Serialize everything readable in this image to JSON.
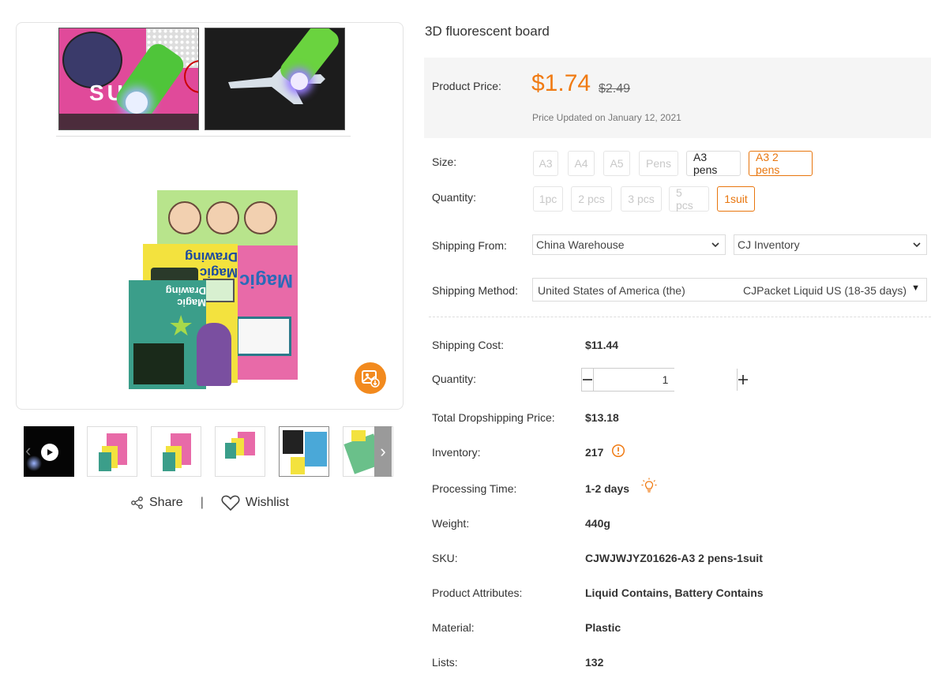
{
  "product": {
    "title": "3D fluorescent board",
    "price_label": "Product Price:",
    "price_current": "$1.74",
    "price_original": "$2.49",
    "price_updated": "Price Updated on January 12, 2021"
  },
  "variants": {
    "size_label": "Size:",
    "sizes": [
      {
        "label": "A3",
        "state": "disabled"
      },
      {
        "label": "A4",
        "state": "disabled"
      },
      {
        "label": "A5",
        "state": "disabled"
      },
      {
        "label": "Pens",
        "state": "disabled"
      },
      {
        "label": "A3 pens",
        "state": "enabled"
      },
      {
        "label": "A3 2 pens",
        "state": "selected"
      }
    ],
    "quantity_label": "Quantity:",
    "quantities": [
      {
        "label": "1pc",
        "state": "disabled"
      },
      {
        "label": "2 pcs",
        "state": "disabled"
      },
      {
        "label": "3 pcs",
        "state": "disabled"
      },
      {
        "label": "5 pcs",
        "state": "disabled"
      },
      {
        "label": "1suit",
        "state": "selected"
      }
    ]
  },
  "shipping": {
    "from_label": "Shipping From:",
    "from_value": "China Warehouse",
    "inventory_value": "CJ Inventory",
    "method_label": "Shipping Method:",
    "method_country": "United States of America (the)",
    "method_carrier": "CJPacket Liquid US (18-35 days)"
  },
  "details": {
    "shipping_cost_label": "Shipping Cost:",
    "shipping_cost": "$11.44",
    "quantity_label": "Quantity:",
    "quantity_value": "1",
    "total_label": "Total Dropshipping Price:",
    "total": "$13.18",
    "inventory_label": "Inventory:",
    "inventory": "217",
    "processing_label": "Processing Time:",
    "processing": "1-2 days",
    "weight_label": "Weight:",
    "weight": "440g",
    "sku_label": "SKU:",
    "sku": "CJWJWJYZ01626-A3 2 pens-1suit",
    "attributes_label": "Product Attributes:",
    "attributes": "Liquid Contains, Battery Contains",
    "material_label": "Material:",
    "material": "Plastic",
    "lists_label": "Lists:",
    "lists": "132"
  },
  "social": {
    "share_label": "Share",
    "separator": "|",
    "wishlist_label": "Wishlist"
  },
  "gallery": {
    "box_text": "Magic Drawing",
    "icons": [
      "play-icon",
      "chevron-left-icon",
      "chevron-right-icon",
      "save-image-icon",
      "share-icon",
      "heart-icon",
      "warning-icon",
      "lightbulb-icon",
      "chevron-down-icon"
    ]
  },
  "colors": {
    "accent": "#f07b14",
    "selected_border": "#e8760e",
    "save_button": "#f28a1e"
  }
}
